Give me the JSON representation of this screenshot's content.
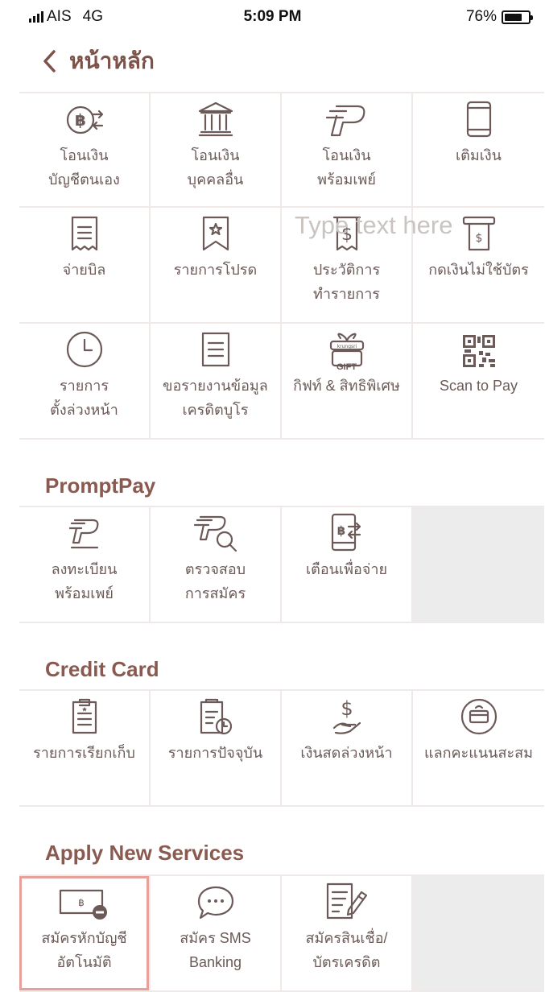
{
  "status_bar": {
    "carrier": "AIS",
    "network": "4G",
    "time": "5:09 PM",
    "battery": "76%",
    "battery_level": 0.76
  },
  "header": {
    "title": "หน้าหลัก"
  },
  "overlay_placeholder": "Type text here",
  "main_menu": [
    {
      "icon": "baht-transfer-icon",
      "label": "โอนเงิน\nบัญชีตนเอง"
    },
    {
      "icon": "bank-icon",
      "label": "โอนเงิน\nบุคคลอื่น"
    },
    {
      "icon": "promptpay-icon",
      "label": "โอนเงิน\nพร้อมเพย์"
    },
    {
      "icon": "mobile-topup-icon",
      "label": "เติมเงิน"
    },
    {
      "icon": "bill-icon",
      "label": "จ่ายบิล"
    },
    {
      "icon": "favorite-bookmark-icon",
      "label": "รายการโปรด"
    },
    {
      "icon": "transaction-history-icon",
      "label": "ประวัติการ\nทำรายการ"
    },
    {
      "icon": "cardless-atm-icon",
      "label": "กดเงินไม่ใช้บัตร"
    },
    {
      "icon": "clock-icon",
      "label": "รายการ\nตั้งล่วงหน้า"
    },
    {
      "icon": "credit-report-icon",
      "label": "ขอรายงานข้อมูล\nเครดิตบูโร"
    },
    {
      "icon": "gift-icon",
      "label": "กิฟท์ & สิทธิพิเศษ",
      "badge": "GIFT"
    },
    {
      "icon": "qr-code-icon",
      "label": "Scan to Pay"
    }
  ],
  "promptpay": {
    "title": "PromptPay",
    "items": [
      {
        "icon": "promptpay-register-icon",
        "label": "ลงทะเบียน\nพร้อมเพย์"
      },
      {
        "icon": "promptpay-check-icon",
        "label": "ตรวจสอบ\nการสมัคร"
      },
      {
        "icon": "payment-alert-icon",
        "label": "เตือนเพื่อจ่าย"
      }
    ]
  },
  "credit_card": {
    "title": "Credit Card",
    "items": [
      {
        "icon": "billing-clipboard-icon",
        "label": "รายการเรียกเก็บ"
      },
      {
        "icon": "current-transactions-icon",
        "label": "รายการปัจจุบัน"
      },
      {
        "icon": "cash-advance-icon",
        "label": "เงินสดล่วงหน้า"
      },
      {
        "icon": "redeem-points-icon",
        "label": "แลกคะแนนสะสม"
      }
    ]
  },
  "apply_services": {
    "title": "Apply New Services",
    "items": [
      {
        "icon": "direct-debit-icon",
        "label": "สมัครหักบัญชี\nอัตโนมัติ"
      },
      {
        "icon": "sms-chat-icon",
        "label": "สมัคร SMS\nBanking"
      },
      {
        "icon": "loan-application-icon",
        "label": "สมัครสินเชื่อ/\nบัตรเครดิต"
      }
    ]
  }
}
